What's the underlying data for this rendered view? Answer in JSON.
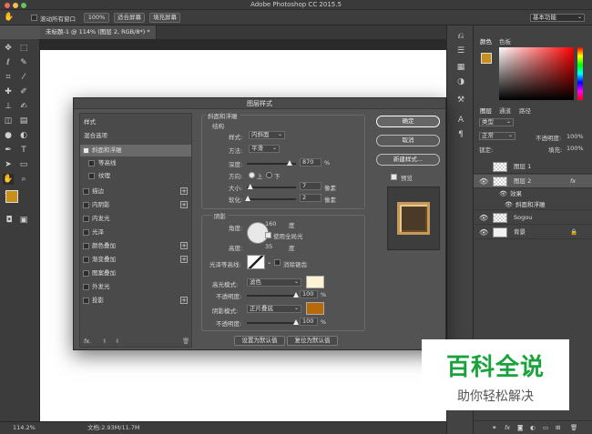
{
  "window": {
    "title": "Adobe Photoshop CC 2015.5"
  },
  "options_bar": {
    "scroll_all_windows": "滚动所有窗口",
    "zoom_100": "100%",
    "fit_screen": "适合屏幕",
    "fill_screen": "填充屏幕",
    "workspace": "基本功能"
  },
  "document_tab": {
    "label": "未标题-1 @ 114% (图层 2, RGB/8*) *",
    "close": "×"
  },
  "status_bar": {
    "zoom": "114.2%",
    "doc_info": "文档:2.93M/11.7M"
  },
  "color_panel": {
    "tab_color": "颜色",
    "tab_swatches": "色板",
    "foreground": "#c8901a",
    "background": "#ffffff"
  },
  "layers_panel": {
    "tabs": [
      "图层",
      "通道",
      "路径"
    ],
    "filter_kind": "类型",
    "blend_mode": "正常",
    "opacity_label": "不透明度:",
    "opacity_value": "100%",
    "lock_label": "锁定:",
    "fill_label": "填充:",
    "fill_value": "100%",
    "layers": [
      {
        "name": "图层 1"
      },
      {
        "name": "图层 2",
        "fx": "fx"
      },
      {
        "name": "效果"
      },
      {
        "name": "斜面和浮雕"
      },
      {
        "name": "Sogou"
      },
      {
        "name": "背景"
      }
    ]
  },
  "dialog": {
    "title": "图层样式",
    "styles_header": "样式",
    "blend_options": "混合选项",
    "style_items": [
      {
        "label": "斜面和浮雕",
        "checked": true
      },
      {
        "label": "等高线",
        "checked": false
      },
      {
        "label": "纹理",
        "checked": false
      },
      {
        "label": "描边",
        "checked": false
      },
      {
        "label": "内阴影",
        "checked": false
      },
      {
        "label": "内发光",
        "checked": false
      },
      {
        "label": "光泽",
        "checked": false
      },
      {
        "label": "颜色叠加",
        "checked": false
      },
      {
        "label": "渐变叠加",
        "checked": false
      },
      {
        "label": "图案叠加",
        "checked": false
      },
      {
        "label": "外发光",
        "checked": false
      },
      {
        "label": "投影",
        "checked": false
      }
    ],
    "fx_label": "fx.",
    "bevel": {
      "group_title": "斜面和浮雕",
      "structure_title": "结构",
      "style_label": "样式:",
      "style_value": "内斜面",
      "technique_label": "方法:",
      "technique_value": "平滑",
      "depth_label": "深度:",
      "depth_value": "870",
      "depth_pct": 0.87,
      "percent": "%",
      "direction_label": "方向:",
      "dir_up": "上",
      "dir_down": "下",
      "size_label": "大小:",
      "size_value": "7",
      "size_frac": 0.07,
      "soften_label": "软化:",
      "soften_value": "2",
      "soften_frac": 0.02,
      "px": "像素"
    },
    "shading": {
      "title": "阴影",
      "angle_label": "角度:",
      "angle_value": "160",
      "altitude_label": "高度:",
      "altitude_value": "35",
      "degree": "度",
      "global_light": "使用全局光",
      "gloss_contour_label": "光泽等高线:",
      "anti_alias": "消除锯齿",
      "highlight_mode_label": "高光模式:",
      "highlight_mode": "滤色",
      "highlight_color": "#fbf3d2",
      "highlight_opacity_label": "不透明度:",
      "highlight_opacity": "100",
      "shadow_mode_label": "阴影模式:",
      "shadow_mode": "正片叠底",
      "shadow_color": "#b86a0a",
      "shadow_opacity_label": "不透明度:",
      "shadow_opacity": "100",
      "percent": "%"
    },
    "set_default": "设置为默认值",
    "reset_default": "复位为默认值",
    "ok": "确定",
    "cancel": "取消",
    "new_style": "新建样式...",
    "preview": "预览"
  },
  "watermark": {
    "title": "百科全说",
    "subtitle": "助你轻松解决"
  }
}
